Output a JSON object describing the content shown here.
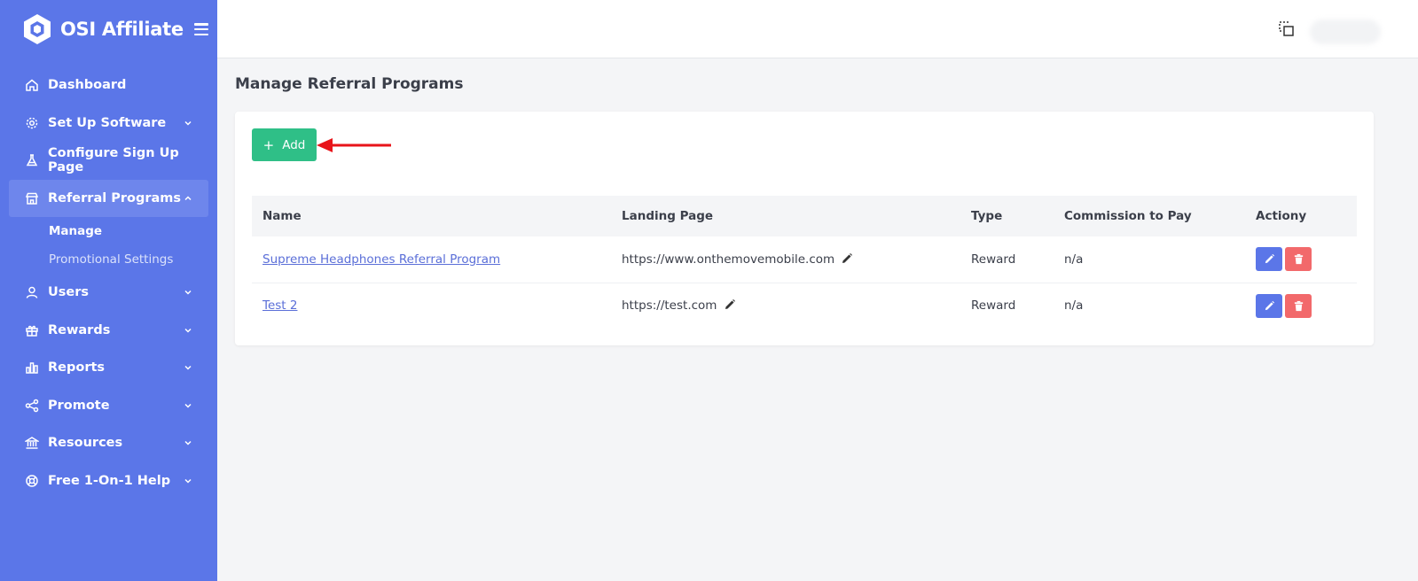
{
  "app": {
    "name": "OSI Affiliate"
  },
  "sidebar": {
    "items": [
      {
        "label": "Dashboard",
        "icon": "home-icon",
        "chevron": false
      },
      {
        "label": "Set Up Software",
        "icon": "gear-icon",
        "chevron": "down"
      },
      {
        "label": "Configure Sign Up Page",
        "icon": "flask-icon",
        "chevron": false
      },
      {
        "label": "Referral Programs",
        "icon": "store-icon",
        "chevron": "up",
        "active": true,
        "sub": [
          {
            "label": "Manage",
            "current": true
          },
          {
            "label": "Promotional Settings"
          }
        ]
      },
      {
        "label": "Users",
        "icon": "user-icon",
        "chevron": "down"
      },
      {
        "label": "Rewards",
        "icon": "gift-icon",
        "chevron": "down"
      },
      {
        "label": "Reports",
        "icon": "bar-chart-icon",
        "chevron": "down"
      },
      {
        "label": "Promote",
        "icon": "share-icon",
        "chevron": "down"
      },
      {
        "label": "Resources",
        "icon": "bank-icon",
        "chevron": "down"
      },
      {
        "label": "Free 1-On-1 Help",
        "icon": "lifebuoy-icon",
        "chevron": "down"
      }
    ]
  },
  "main": {
    "title": "Manage Referral Programs",
    "add_label": "Add",
    "table": {
      "headers": [
        "Name",
        "Landing Page",
        "Type",
        "Commission to Pay",
        "Actiony"
      ],
      "rows": [
        {
          "name": "Supreme Headphones Referral Program",
          "landing": "https://www.onthemovemobile.com",
          "type": "Reward",
          "commission": "n/a"
        },
        {
          "name": "Test 2",
          "landing": "https://test.com",
          "type": "Reward",
          "commission": "n/a"
        }
      ]
    }
  },
  "colors": {
    "sidebar": "#5b76e8",
    "add_button": "#2fbf87",
    "edit_button": "#5b76e8",
    "delete_button": "#f2696b",
    "annotation_arrow": "#e8141a"
  }
}
